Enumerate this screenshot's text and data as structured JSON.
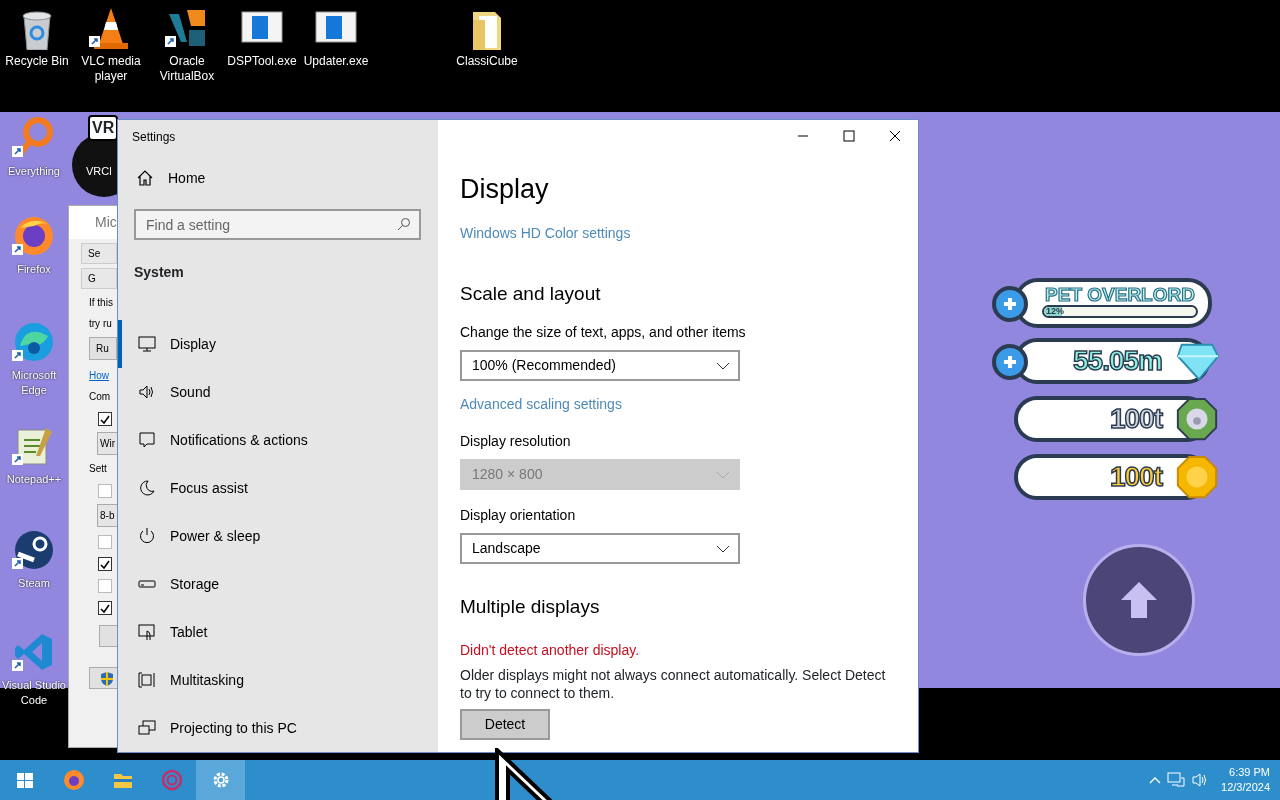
{
  "desktop_top_icons": [
    {
      "label": "Recycle Bin",
      "kind": "recycle"
    },
    {
      "label": "VLC media player",
      "kind": "cone"
    },
    {
      "label": "Oracle VirtualBox",
      "kind": "vbox"
    },
    {
      "label": "DSPTool.exe",
      "kind": "exe"
    },
    {
      "label": "Updater.exe",
      "kind": "exe"
    },
    {
      "label": "ClassiCube",
      "kind": "folder"
    }
  ],
  "desktop_left_icons": [
    {
      "label": "Everything",
      "kind": "magnifier"
    },
    {
      "label": "Firefox",
      "kind": "firefox"
    },
    {
      "label": "Microsoft Edge",
      "kind": "edge"
    },
    {
      "label": "Notepad++",
      "kind": "notepad"
    },
    {
      "label": "Steam",
      "kind": "steam"
    },
    {
      "label": "Visual Studio Code",
      "kind": "vscode"
    }
  ],
  "partial_icon": {
    "label": "VRCl",
    "badge": "VR"
  },
  "background_window": {
    "title": "Mic",
    "items": [
      {
        "kind": "tab",
        "text": "Se"
      },
      {
        "kind": "tab",
        "text": "G"
      },
      {
        "kind": "text",
        "text": "If this"
      },
      {
        "kind": "text",
        "text": "try ru"
      },
      {
        "kind": "button",
        "text": "Ru"
      },
      {
        "kind": "link",
        "text": "How"
      },
      {
        "kind": "text",
        "text": "Com"
      },
      {
        "kind": "checkbox",
        "checked": true
      },
      {
        "kind": "field",
        "text": "Wir"
      },
      {
        "kind": "text",
        "text": "Sett"
      },
      {
        "kind": "checkbox",
        "checked": false
      },
      {
        "kind": "field",
        "text": "8-b"
      },
      {
        "kind": "checkbox",
        "checked": false
      },
      {
        "kind": "checkbox",
        "checked": true
      },
      {
        "kind": "checkbox",
        "checked": false
      },
      {
        "kind": "checkbox",
        "checked": true
      },
      {
        "kind": "blank-button"
      },
      {
        "kind": "shield-button"
      }
    ]
  },
  "settings_window": {
    "title": "Settings",
    "sidebar": {
      "home": "Home",
      "search": {
        "placeholder": "Find a setting"
      },
      "section": "System",
      "items": [
        {
          "label": "Display",
          "kind": "display",
          "selected": true
        },
        {
          "label": "Sound",
          "kind": "sound",
          "selected": false
        },
        {
          "label": "Notifications & actions",
          "kind": "notifications",
          "selected": false
        },
        {
          "label": "Focus assist",
          "kind": "focus",
          "selected": false
        },
        {
          "label": "Power & sleep",
          "kind": "power",
          "selected": false
        },
        {
          "label": "Storage",
          "kind": "storage",
          "selected": false
        },
        {
          "label": "Tablet",
          "kind": "tablet",
          "selected": false
        },
        {
          "label": "Multitasking",
          "kind": "multitasking",
          "selected": false
        },
        {
          "label": "Projecting to this PC",
          "kind": "projecting",
          "selected": false
        }
      ]
    },
    "content": {
      "title": "Display",
      "hd_link": "Windows HD Color settings",
      "scale": {
        "heading": "Scale and layout",
        "rows": [
          {
            "kind": "label",
            "text": "Change the size of text, apps, and other items"
          },
          {
            "kind": "dropdown",
            "value": "100% (Recommended)",
            "disabled": false
          },
          {
            "kind": "link",
            "text": "Advanced scaling settings"
          },
          {
            "kind": "label",
            "text": "Display resolution"
          },
          {
            "kind": "dropdown",
            "value": "1280 × 800",
            "disabled": true
          },
          {
            "kind": "label",
            "text": "Display orientation"
          },
          {
            "kind": "dropdown",
            "value": "Landscape",
            "disabled": false
          }
        ]
      },
      "multiple": {
        "heading": "Multiple displays",
        "error": "Didn't detect another display.",
        "description": "Older displays might not always connect automatically. Select Detect to try to connect to them.",
        "button": "Detect"
      }
    }
  },
  "game_hud": {
    "rank": {
      "title": "PET OVERLORD",
      "percent": "12%",
      "level": 0.12,
      "has_plus": true
    },
    "currencies": [
      {
        "value": "55.05m",
        "kind": "gem",
        "has_plus": true
      },
      {
        "value": "100t",
        "kind": "paw-coin",
        "has_plus": false
      },
      {
        "value": "100t",
        "kind": "gold-coin",
        "has_plus": false
      }
    ]
  },
  "taskbar": {
    "apps": [
      {
        "kind": "start",
        "selected": false
      },
      {
        "kind": "firefox",
        "selected": false
      },
      {
        "kind": "explorer",
        "selected": false
      },
      {
        "kind": "ring",
        "selected": false
      },
      {
        "kind": "settings",
        "selected": true
      }
    ],
    "time": "6:39 PM",
    "date": "12/3/2024"
  }
}
